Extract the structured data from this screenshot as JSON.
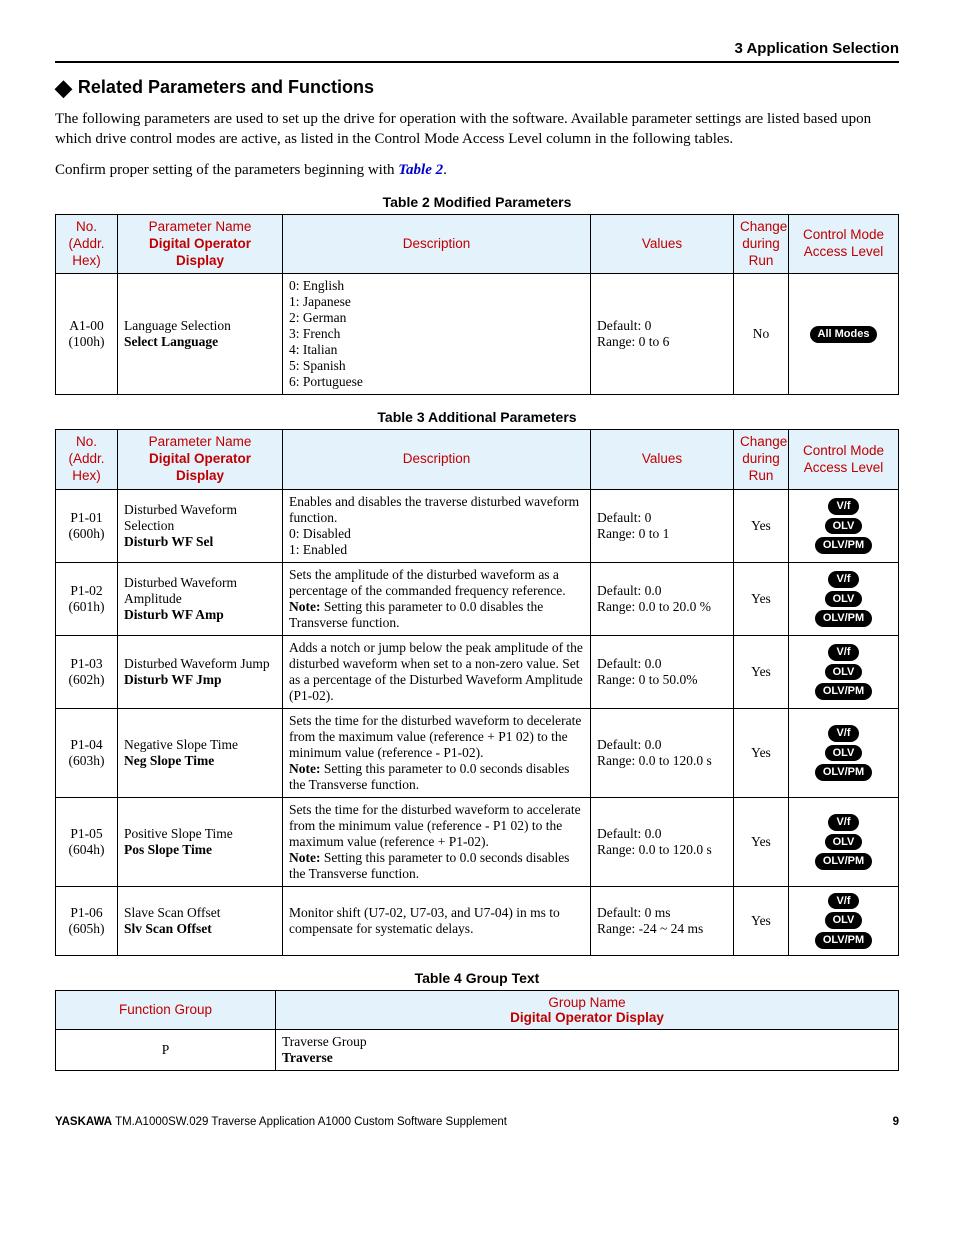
{
  "header": {
    "section": "3  Application Selection"
  },
  "section": {
    "title": "Related Parameters and Functions",
    "p1": "The following parameters are used to set up the drive for operation with the software. Available parameter settings are listed based upon which drive control modes are active, as listed in the Control Mode Access Level column in the following tables.",
    "p2a": "Confirm proper setting of the parameters beginning with ",
    "p2_link": "Table 2",
    "p2b": "."
  },
  "headers": {
    "no": "No. (Addr. Hex)",
    "name": "Parameter Name",
    "name_b": "Digital Operator Display",
    "desc": "Description",
    "val": "Values",
    "chg": "Change during Run",
    "mode": "Control Mode Access Level"
  },
  "captions": {
    "t2": "Table 2  Modified Parameters",
    "t3": "Table 3  Additional Parameters",
    "t4": "Table 4  Group Text"
  },
  "t2": {
    "rows": [
      {
        "no": "A1-00 (100h)",
        "name": "Language Selection",
        "disp": "Select Language",
        "desc": "0: English\n1: Japanese\n2: German\n3: French\n4: Italian\n5: Spanish\n6: Portuguese",
        "val": "Default: 0\nRange: 0 to 6",
        "chg": "No",
        "modes": [
          "All Modes"
        ]
      }
    ]
  },
  "t3": {
    "rows": [
      {
        "no": "P1-01 (600h)",
        "name": "Disturbed Waveform Selection",
        "disp": "Disturb WF Sel",
        "desc": "Enables and disables the traverse disturbed waveform function.\n0: Disabled\n1: Enabled",
        "val": "Default: 0\nRange: 0 to 1",
        "chg": "Yes",
        "modes": [
          "V/f",
          "OLV",
          "OLV/PM"
        ]
      },
      {
        "no": "P1-02 (601h)",
        "name": "Disturbed Waveform Amplitude",
        "disp": "Disturb WF Amp",
        "desc": "Sets the amplitude of the disturbed waveform as a percentage of the commanded frequency reference.",
        "note": "Setting this parameter to 0.0 disables the Transverse function.",
        "val": "Default: 0.0\nRange: 0.0 to 20.0 %",
        "chg": "Yes",
        "modes": [
          "V/f",
          "OLV",
          "OLV/PM"
        ]
      },
      {
        "no": "P1-03 (602h)",
        "name": "Disturbed Waveform Jump",
        "disp": "Disturb WF Jmp",
        "desc": "Adds a notch or jump below the peak amplitude of the disturbed waveform when set to a non-zero value.  Set as a percentage of the Disturbed Waveform Amplitude (P1-02).",
        "val": "Default: 0.0\nRange: 0 to 50.0%",
        "chg": "Yes",
        "modes": [
          "V/f",
          "OLV",
          "OLV/PM"
        ]
      },
      {
        "no": "P1-04 (603h)",
        "name": "Negative Slope Time",
        "disp": "Neg Slope Time",
        "desc": "Sets the time for the disturbed waveform to decelerate from the maximum value (reference + P1 02) to the minimum value (reference - P1-02).",
        "note": "Setting this parameter to 0.0 seconds disables the Transverse function.",
        "val": "Default: 0.0\nRange: 0.0 to 120.0 s",
        "chg": "Yes",
        "modes": [
          "V/f",
          "OLV",
          "OLV/PM"
        ]
      },
      {
        "no": "P1-05 (604h)",
        "name": "Positive Slope Time",
        "disp": "Pos Slope Time",
        "desc": "Sets the time for the disturbed waveform to accelerate from the minimum value (reference - P1 02) to the maximum value (reference + P1-02).",
        "note": "Setting this parameter to 0.0 seconds disables the Transverse function.",
        "val": "Default: 0.0\nRange: 0.0 to 120.0 s",
        "chg": "Yes",
        "modes": [
          "V/f",
          "OLV",
          "OLV/PM"
        ]
      },
      {
        "no": "P1-06 (605h)",
        "name": "Slave Scan Offset",
        "disp": "Slv Scan Offset",
        "desc": "Monitor shift (U7-02, U7-03, and U7-04) in ms to compensate for systematic delays.",
        "val": "Default: 0 ms\nRange: -24 ~ 24 ms",
        "chg": "Yes",
        "modes": [
          "V/f",
          "OLV",
          "OLV/PM"
        ]
      }
    ]
  },
  "t4": {
    "headers": {
      "fg": "Function Group",
      "gn": "Group Name",
      "gn_b": "Digital Operator Display"
    },
    "rows": [
      {
        "fg": "P",
        "name": "Traverse Group",
        "disp": "Traverse"
      }
    ]
  },
  "note_label": "Note: ",
  "footer": {
    "brand": "YASKAWA",
    "doc": " TM.A1000SW.029 Traverse Application A1000 Custom Software Supplement",
    "page": "9"
  }
}
